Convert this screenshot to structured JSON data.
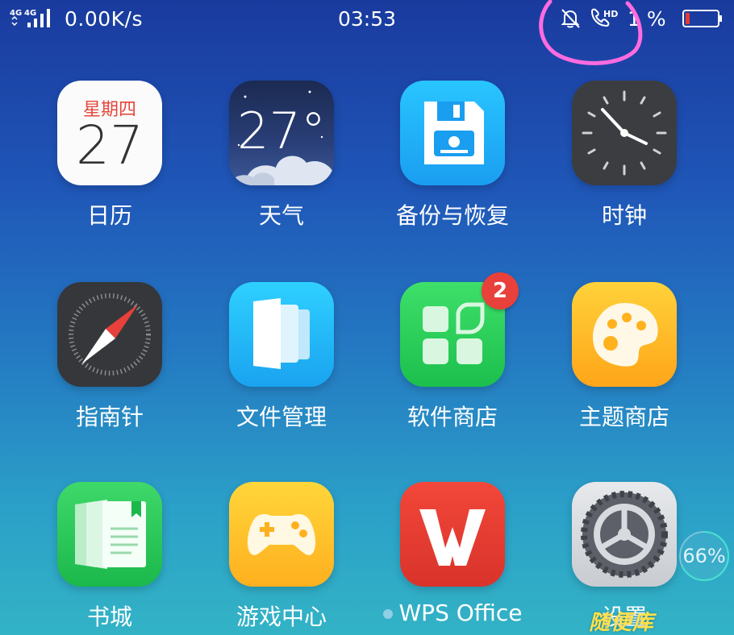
{
  "status_bar": {
    "network": "4G 4G",
    "speed": "0.00K/s",
    "time": "03:53",
    "hd": "HD",
    "battery_text": "1 %",
    "battery_color": "#e53935"
  },
  "apps": [
    {
      "label": "日历",
      "top_text": "星期四",
      "number": "27"
    },
    {
      "label": "天气",
      "number": "27°"
    },
    {
      "label": "备份与恢复"
    },
    {
      "label": "时钟"
    },
    {
      "label": "指南针"
    },
    {
      "label": "文件管理"
    },
    {
      "label": "软件商店",
      "badge": "2"
    },
    {
      "label": "主题商店"
    },
    {
      "label": "书城"
    },
    {
      "label": "游戏中心"
    },
    {
      "label": "WPS Office"
    },
    {
      "label": "设置"
    }
  ],
  "ram_percent": "66%",
  "watermark": "随便库",
  "annotation_color": "#ff6be0"
}
